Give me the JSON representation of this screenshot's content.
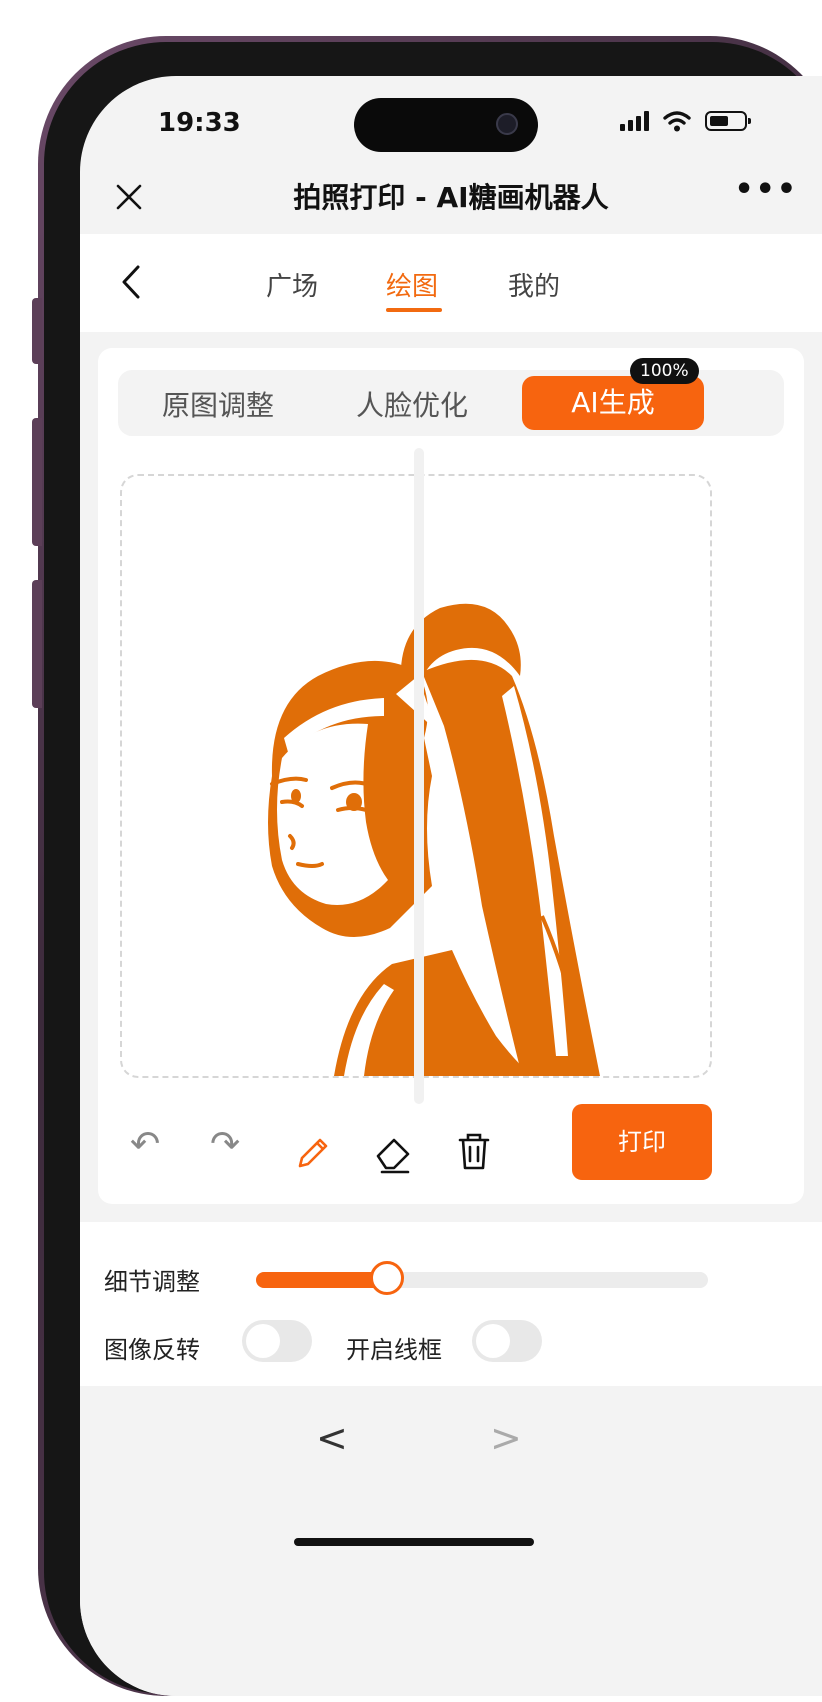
{
  "status": {
    "time": "19:33"
  },
  "header": {
    "close_icon": "close-icon",
    "title": "拍照打印 - AI糖画机器人",
    "more": "•••"
  },
  "nav": {
    "back": "<",
    "tabs": [
      "广场",
      "绘图",
      "我的"
    ],
    "active_tab": "绘图"
  },
  "modes": {
    "items": [
      "原图调整",
      "人脸优化",
      "AI生成"
    ],
    "active": "AI生成",
    "badge": "100%"
  },
  "toolbar": {
    "undo": "↶",
    "redo": "↷",
    "print_label": "打印"
  },
  "settings": {
    "detail_label": "细节调整",
    "detail_value": 0.29,
    "invert_label": "图像反转",
    "invert_on": false,
    "frame_label": "开启线框",
    "frame_on": false
  },
  "bottom_nav": {
    "prev": "<",
    "next": ">"
  },
  "colors": {
    "accent": "#f7640f",
    "drawing": "#e06e08"
  }
}
